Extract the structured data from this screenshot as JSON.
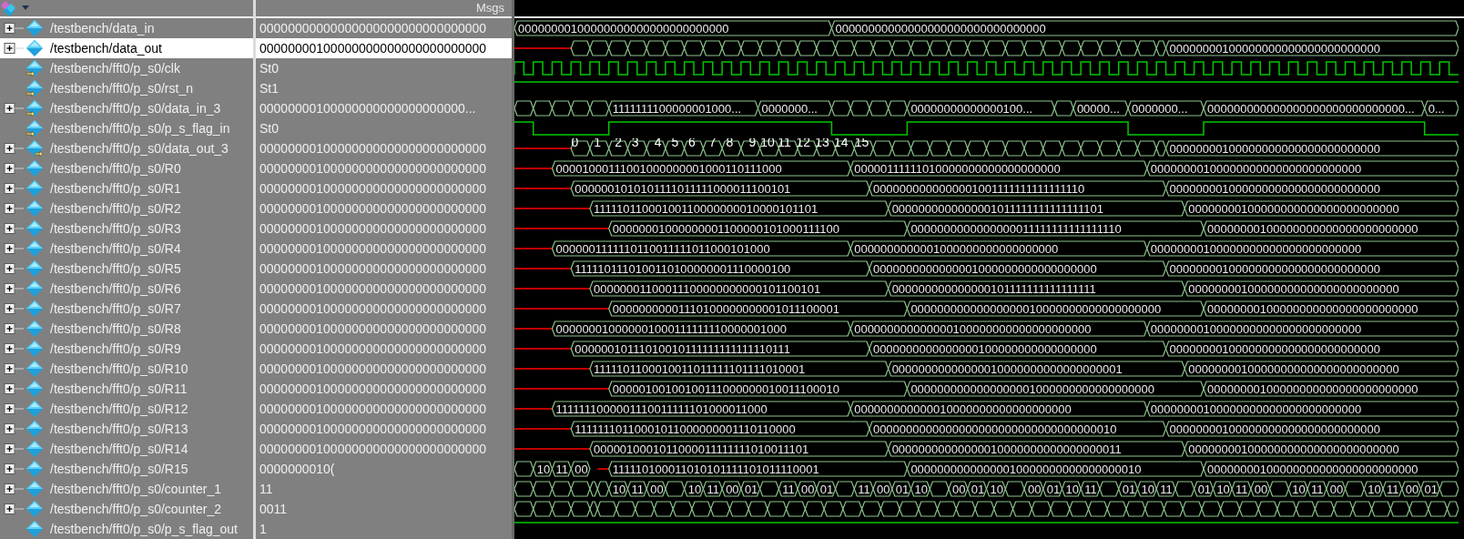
{
  "header": {
    "values_title": "Msgs"
  },
  "rows": [
    {
      "name": "/testbench/data_in",
      "value": "00000000000000000000000000000000",
      "kind": "signal",
      "expandable": true,
      "selected": false,
      "wave": [
        {
          "kind": "bus",
          "value": "00000000100000000000000000000000"
        },
        {
          "kind": "bus",
          "value": "00000000000000000000000000000000"
        }
      ]
    },
    {
      "name": "/testbench/data_out",
      "value": "00000000100000000000000000000000",
      "kind": "signal",
      "expandable": true,
      "selected": true,
      "wave": [
        {
          "kind": "undefined"
        },
        {
          "kind": "toggling"
        },
        {
          "kind": "bus",
          "value": "00000000100000000000000000000000"
        }
      ]
    },
    {
      "name": "/testbench/fft0/p_s0/clk",
      "value": "St0",
      "kind": "input",
      "expandable": false,
      "selected": false,
      "wave": [
        {
          "kind": "clock"
        }
      ]
    },
    {
      "name": "/testbench/fft0/p_s0/rst_n",
      "value": "St1",
      "kind": "input",
      "expandable": false,
      "selected": false,
      "wave": [
        {
          "kind": "high"
        }
      ]
    },
    {
      "name": "/testbench/fft0/p_s0/data_in_3",
      "value": "00000000100000000000000000000...",
      "kind": "input",
      "expandable": true,
      "selected": false,
      "wave": [
        {
          "kind": "toggling"
        },
        {
          "kind": "bus",
          "value": "1111111100000001000..."
        },
        {
          "kind": "bus",
          "value": "0000000..."
        },
        {
          "kind": "toggling"
        },
        {
          "kind": "bus",
          "value": "00000000000000100..."
        },
        {
          "kind": "toggling"
        },
        {
          "kind": "bus",
          "value": "00000..."
        },
        {
          "kind": "bus",
          "value": "0000000..."
        },
        {
          "kind": "bus",
          "value": "000000000000000000000000000000..."
        },
        {
          "kind": "bus",
          "value": "0..."
        }
      ]
    },
    {
      "name": "/testbench/fft0/p_s0/p_s_flag_in",
      "value": "St0",
      "kind": "input",
      "expandable": false,
      "selected": false,
      "wave": [
        {
          "kind": "high"
        },
        {
          "kind": "low"
        },
        {
          "kind": "high"
        },
        {
          "kind": "low"
        },
        {
          "kind": "high"
        },
        {
          "kind": "low"
        },
        {
          "kind": "high"
        },
        {
          "kind": "low"
        }
      ]
    },
    {
      "name": "/testbench/fft0/p_s0/data_out_3",
      "value": "00000000100000000000000000000000",
      "kind": "output",
      "expandable": true,
      "selected": false,
      "wave": [
        {
          "kind": "undefined"
        },
        {
          "kind": "toggling"
        },
        {
          "kind": "bus",
          "value": "00000000100000000000000000000000"
        }
      ],
      "index_labels": [
        "0",
        "1",
        "2",
        "3",
        "4",
        "5",
        "6",
        "7",
        "8",
        "9",
        "10",
        "11",
        "12",
        "13",
        "14",
        "15"
      ]
    },
    {
      "name": "/testbench/fft0/p_s0/R0",
      "value": "00000000100000000000000000000000",
      "kind": "signal",
      "expandable": true,
      "selected": false,
      "wave": [
        {
          "kind": "undefined"
        },
        {
          "kind": "bus",
          "value": "00001000111001000000001000110111000"
        },
        {
          "kind": "bus",
          "value": "00000111111010000000000000000000"
        },
        {
          "kind": "bus",
          "value": "00000000100000000000000000000000"
        }
      ]
    },
    {
      "name": "/testbench/fft0/p_s0/R1",
      "value": "00000000100000000000000000000000",
      "kind": "signal",
      "expandable": true,
      "selected": false,
      "wave": [
        {
          "kind": "undefined"
        },
        {
          "kind": "bus",
          "value": "0000001010101111011111000011100101"
        },
        {
          "kind": "bus",
          "value": "0000000000000001001111111111111110"
        },
        {
          "kind": "bus",
          "value": "00000000100000000000000000000000"
        }
      ]
    },
    {
      "name": "/testbench/fft0/p_s0/R2",
      "value": "00000000100000000000000000000000",
      "kind": "signal",
      "expandable": true,
      "selected": false,
      "wave": [
        {
          "kind": "undefined"
        },
        {
          "kind": "bus",
          "value": "11111011000100110000000010000101101"
        },
        {
          "kind": "bus",
          "value": "0000000000000001011111111111111101"
        },
        {
          "kind": "bus",
          "value": "00000000100000000000000000000000"
        }
      ]
    },
    {
      "name": "/testbench/fft0/p_s0/R3",
      "value": "00000000100000000000000000000000",
      "kind": "signal",
      "expandable": true,
      "selected": false,
      "wave": [
        {
          "kind": "undefined"
        },
        {
          "kind": "bus",
          "value": "00000001000000001100000101000111100"
        },
        {
          "kind": "bus",
          "value": "0000000000000000011111111111111110"
        },
        {
          "kind": "bus",
          "value": "00000000100000000000000000000000"
        }
      ]
    },
    {
      "name": "/testbench/fft0/p_s0/R4",
      "value": "00000000100000000000000000000000",
      "kind": "signal",
      "expandable": true,
      "selected": false,
      "wave": [
        {
          "kind": "undefined"
        },
        {
          "kind": "bus",
          "value": "0000001111110110011111011000101000"
        },
        {
          "kind": "bus",
          "value": "0000000000001000000000000000000"
        },
        {
          "kind": "bus",
          "value": "00000000100000000000000000000000"
        }
      ]
    },
    {
      "name": "/testbench/fft0/p_s0/R5",
      "value": "00000000100000000000000000000000",
      "kind": "signal",
      "expandable": true,
      "selected": false,
      "wave": [
        {
          "kind": "undefined"
        },
        {
          "kind": "bus",
          "value": "1111101110100110100000001110000100"
        },
        {
          "kind": "bus",
          "value": "0000000000000001000000000000000000"
        },
        {
          "kind": "bus",
          "value": "00000000100000000000000000000000"
        }
      ]
    },
    {
      "name": "/testbench/fft0/p_s0/R6",
      "value": "00000000100000000000000000000000",
      "kind": "signal",
      "expandable": true,
      "selected": false,
      "wave": [
        {
          "kind": "undefined"
        },
        {
          "kind": "bus",
          "value": "00000001100011100000000000101100101"
        },
        {
          "kind": "bus",
          "value": "000000000000000101111111111111111"
        },
        {
          "kind": "bus",
          "value": "00000000100000000000000000000000"
        }
      ]
    },
    {
      "name": "/testbench/fft0/p_s0/R7",
      "value": "00000000100000000000000000000000",
      "kind": "signal",
      "expandable": true,
      "selected": false,
      "wave": [
        {
          "kind": "undefined"
        },
        {
          "kind": "bus",
          "value": "00000000001110100000000001011100001"
        },
        {
          "kind": "bus",
          "value": "00000000000000000010000000000000000000"
        },
        {
          "kind": "bus",
          "value": "00000000100000000000000000000000"
        }
      ]
    },
    {
      "name": "/testbench/fft0/p_s0/R8",
      "value": "00000000100000000000000000000000",
      "kind": "signal",
      "expandable": true,
      "selected": false,
      "wave": [
        {
          "kind": "undefined"
        },
        {
          "kind": "bus",
          "value": "000000010000001000111111110000001000"
        },
        {
          "kind": "bus",
          "value": "000000000000000100000000000000000000"
        },
        {
          "kind": "bus",
          "value": "00000000100000000000000000000000"
        }
      ]
    },
    {
      "name": "/testbench/fft0/p_s0/R9",
      "value": "00000000100000000000000000000000",
      "kind": "signal",
      "expandable": true,
      "selected": false,
      "wave": [
        {
          "kind": "undefined"
        },
        {
          "kind": "bus",
          "value": "00000010111010010111111111111110111"
        },
        {
          "kind": "bus",
          "value": "0000000000000000100000000000000000"
        },
        {
          "kind": "bus",
          "value": "00000000100000000000000000000000"
        }
      ]
    },
    {
      "name": "/testbench/fft0/p_s0/R10",
      "value": "00000000100000000000000000000000",
      "kind": "signal",
      "expandable": true,
      "selected": false,
      "wave": [
        {
          "kind": "undefined"
        },
        {
          "kind": "bus",
          "value": "1111101100010011011111101111010001"
        },
        {
          "kind": "bus",
          "value": "00000000000000010000000000000000001"
        },
        {
          "kind": "bus",
          "value": "00000000100000000000000000000000"
        }
      ]
    },
    {
      "name": "/testbench/fft0/p_s0/R11",
      "value": "00000000100000000000000000000000",
      "kind": "signal",
      "expandable": true,
      "selected": false,
      "wave": [
        {
          "kind": "undefined"
        },
        {
          "kind": "bus",
          "value": "00000100100100111000000010011100010"
        },
        {
          "kind": "bus",
          "value": "0000000000000000001000000000000000000"
        },
        {
          "kind": "bus",
          "value": "00000000100000000000000000000000"
        }
      ]
    },
    {
      "name": "/testbench/fft0/p_s0/R12",
      "value": "00000000100000000000000000000000",
      "kind": "signal",
      "expandable": true,
      "selected": false,
      "wave": [
        {
          "kind": "undefined"
        },
        {
          "kind": "bus",
          "value": "1111111000001110011111101000011000"
        },
        {
          "kind": "bus",
          "value": "000000000000010000000000000000000"
        },
        {
          "kind": "bus",
          "value": "00000000100000000000000000000000"
        }
      ]
    },
    {
      "name": "/testbench/fft0/p_s0/R13",
      "value": "00000000100000000000000000000000",
      "kind": "signal",
      "expandable": true,
      "selected": false,
      "wave": [
        {
          "kind": "undefined"
        },
        {
          "kind": "bus",
          "value": "11111110110001011000000001110110000"
        },
        {
          "kind": "bus",
          "value": "0000000000000000000000000000000000010"
        },
        {
          "kind": "bus",
          "value": "00000000100000000000000000000000"
        }
      ]
    },
    {
      "name": "/testbench/fft0/p_s0/R14",
      "value": "00000000100000000000000000000000",
      "kind": "signal",
      "expandable": true,
      "selected": false,
      "wave": [
        {
          "kind": "undefined"
        },
        {
          "kind": "bus",
          "value": "0000010001011000011111111010011101"
        },
        {
          "kind": "bus",
          "value": "00000000000000010000000000000000011"
        },
        {
          "kind": "bus",
          "value": "00000000100000000000000000000000"
        }
      ]
    },
    {
      "name": "/testbench/fft0/p_s0/R15",
      "value": "0000000010(",
      "kind": "signal",
      "expandable": true,
      "selected": false,
      "wave": [
        {
          "kind": "bus"
        },
        {
          "kind": "bus",
          "value": "10"
        },
        {
          "kind": "bus",
          "value": "11"
        },
        {
          "kind": "bus",
          "value": "00"
        },
        {
          "kind": "undefined"
        },
        {
          "kind": "bus",
          "value": "111110100011010101111101011110001"
        },
        {
          "kind": "bus",
          "value": "00000000000000010000000000000000010"
        },
        {
          "kind": "bus",
          "value": "00000000100000000000000000000000"
        }
      ]
    },
    {
      "name": "/testbench/fft0/p_s0/counter_1",
      "value": "11",
      "kind": "signal",
      "expandable": true,
      "selected": false,
      "wave": [
        {
          "kind": "toggling"
        },
        {
          "kind": "bus"
        },
        {
          "kind": "bus",
          "value": "10"
        },
        {
          "kind": "bus",
          "value": "11"
        },
        {
          "kind": "bus",
          "value": "00"
        },
        {
          "kind": "bus"
        },
        {
          "kind": "bus",
          "value": "10"
        },
        {
          "kind": "bus",
          "value": "11"
        },
        {
          "kind": "bus",
          "value": "00"
        },
        {
          "kind": "bus",
          "value": "01"
        },
        {
          "kind": "bus"
        },
        {
          "kind": "bus",
          "value": "11"
        },
        {
          "kind": "bus",
          "value": "00"
        },
        {
          "kind": "bus",
          "value": "01"
        },
        {
          "kind": "bus"
        },
        {
          "kind": "bus",
          "value": "11"
        },
        {
          "kind": "bus",
          "value": "00"
        },
        {
          "kind": "bus",
          "value": "01"
        },
        {
          "kind": "bus",
          "value": "10"
        },
        {
          "kind": "bus"
        },
        {
          "kind": "bus",
          "value": "00"
        },
        {
          "kind": "bus",
          "value": "01"
        },
        {
          "kind": "bus",
          "value": "10"
        },
        {
          "kind": "bus"
        },
        {
          "kind": "bus",
          "value": "00"
        },
        {
          "kind": "bus",
          "value": "01"
        },
        {
          "kind": "bus",
          "value": "10"
        },
        {
          "kind": "bus",
          "value": "11"
        },
        {
          "kind": "bus"
        },
        {
          "kind": "bus",
          "value": "01"
        },
        {
          "kind": "bus",
          "value": "10"
        },
        {
          "kind": "bus",
          "value": "11"
        },
        {
          "kind": "bus"
        },
        {
          "kind": "bus",
          "value": "01"
        },
        {
          "kind": "bus",
          "value": "10"
        },
        {
          "kind": "bus",
          "value": "11"
        },
        {
          "kind": "bus",
          "value": "00"
        },
        {
          "kind": "bus"
        },
        {
          "kind": "bus",
          "value": "10"
        },
        {
          "kind": "bus",
          "value": "11"
        },
        {
          "kind": "bus",
          "value": "00"
        },
        {
          "kind": "bus"
        },
        {
          "kind": "bus",
          "value": "10"
        },
        {
          "kind": "bus",
          "value": "11"
        },
        {
          "kind": "bus",
          "value": "00"
        },
        {
          "kind": "bus",
          "value": "01"
        },
        {
          "kind": "bus"
        }
      ]
    },
    {
      "name": "/testbench/fft0/p_s0/counter_2",
      "value": "0011",
      "kind": "signal",
      "expandable": true,
      "selected": false,
      "wave": [
        {
          "kind": "toggling"
        },
        {
          "kind": "toggling"
        }
      ]
    },
    {
      "name": "/testbench/fft0/p_s0/p_s_flag_out",
      "value": "1",
      "kind": "signal",
      "expandable": false,
      "selected": false,
      "wave": [
        {
          "kind": "high"
        }
      ]
    }
  ]
}
